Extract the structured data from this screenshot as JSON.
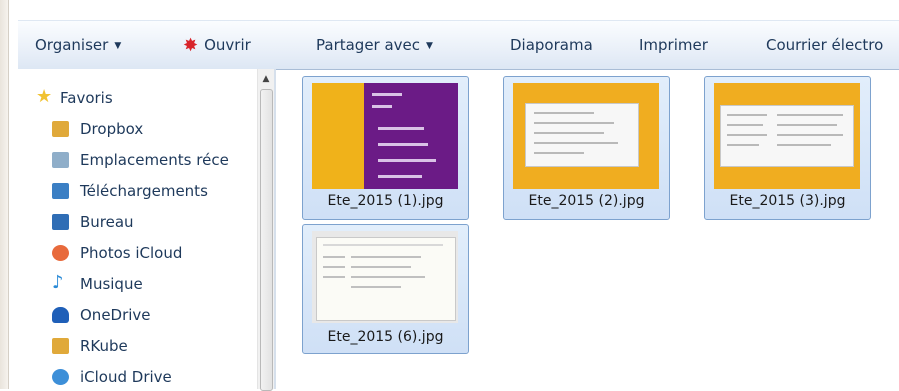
{
  "toolbar": {
    "items": [
      {
        "label": "Organiser",
        "has_menu": true
      },
      {
        "label": "Ouvrir",
        "icon": "open-with-icon"
      },
      {
        "label": "Partager avec",
        "has_menu": true
      },
      {
        "label": "Diaporama"
      },
      {
        "label": "Imprimer"
      },
      {
        "label": "Courrier électro"
      }
    ]
  },
  "nav": {
    "items": [
      {
        "label": "Favoris",
        "icon": "star-icon",
        "color": "#f1c232"
      },
      {
        "label": "Dropbox",
        "icon": "folder-icon",
        "color": "#e0a93a"
      },
      {
        "label": "Emplacements réce",
        "icon": "recent-places-icon",
        "color": "#8faec9"
      },
      {
        "label": "Téléchargements",
        "icon": "downloads-icon",
        "color": "#3b7fc4"
      },
      {
        "label": "Bureau",
        "icon": "desktop-icon",
        "color": "#2f6db5"
      },
      {
        "label": "Photos iCloud",
        "icon": "photos-icon",
        "color": "#e86a3c"
      },
      {
        "label": "Musique",
        "icon": "music-icon",
        "color": "#2a8ad6"
      },
      {
        "label": "OneDrive",
        "icon": "onedrive-icon",
        "color": "#1f5fb8"
      },
      {
        "label": "RKube",
        "icon": "folder-icon",
        "color": "#e0a93a"
      },
      {
        "label": "iCloud Drive",
        "icon": "icloud-icon",
        "color": "#3d8fd8"
      }
    ]
  },
  "files": [
    {
      "name": "Ete_2015 (1).jpg",
      "thumb": "purple"
    },
    {
      "name": "Ete_2015 (2).jpg",
      "thumb": "yellow-a"
    },
    {
      "name": "Ete_2015 (3).jpg",
      "thumb": "yellow-b"
    },
    {
      "name": "Ete_2015 (6).jpg",
      "thumb": "gray"
    }
  ],
  "colors": {
    "toolbar_text": "#1e395b",
    "selection_border": "#7da2ce",
    "selection_fill": "#d6e5f7"
  }
}
